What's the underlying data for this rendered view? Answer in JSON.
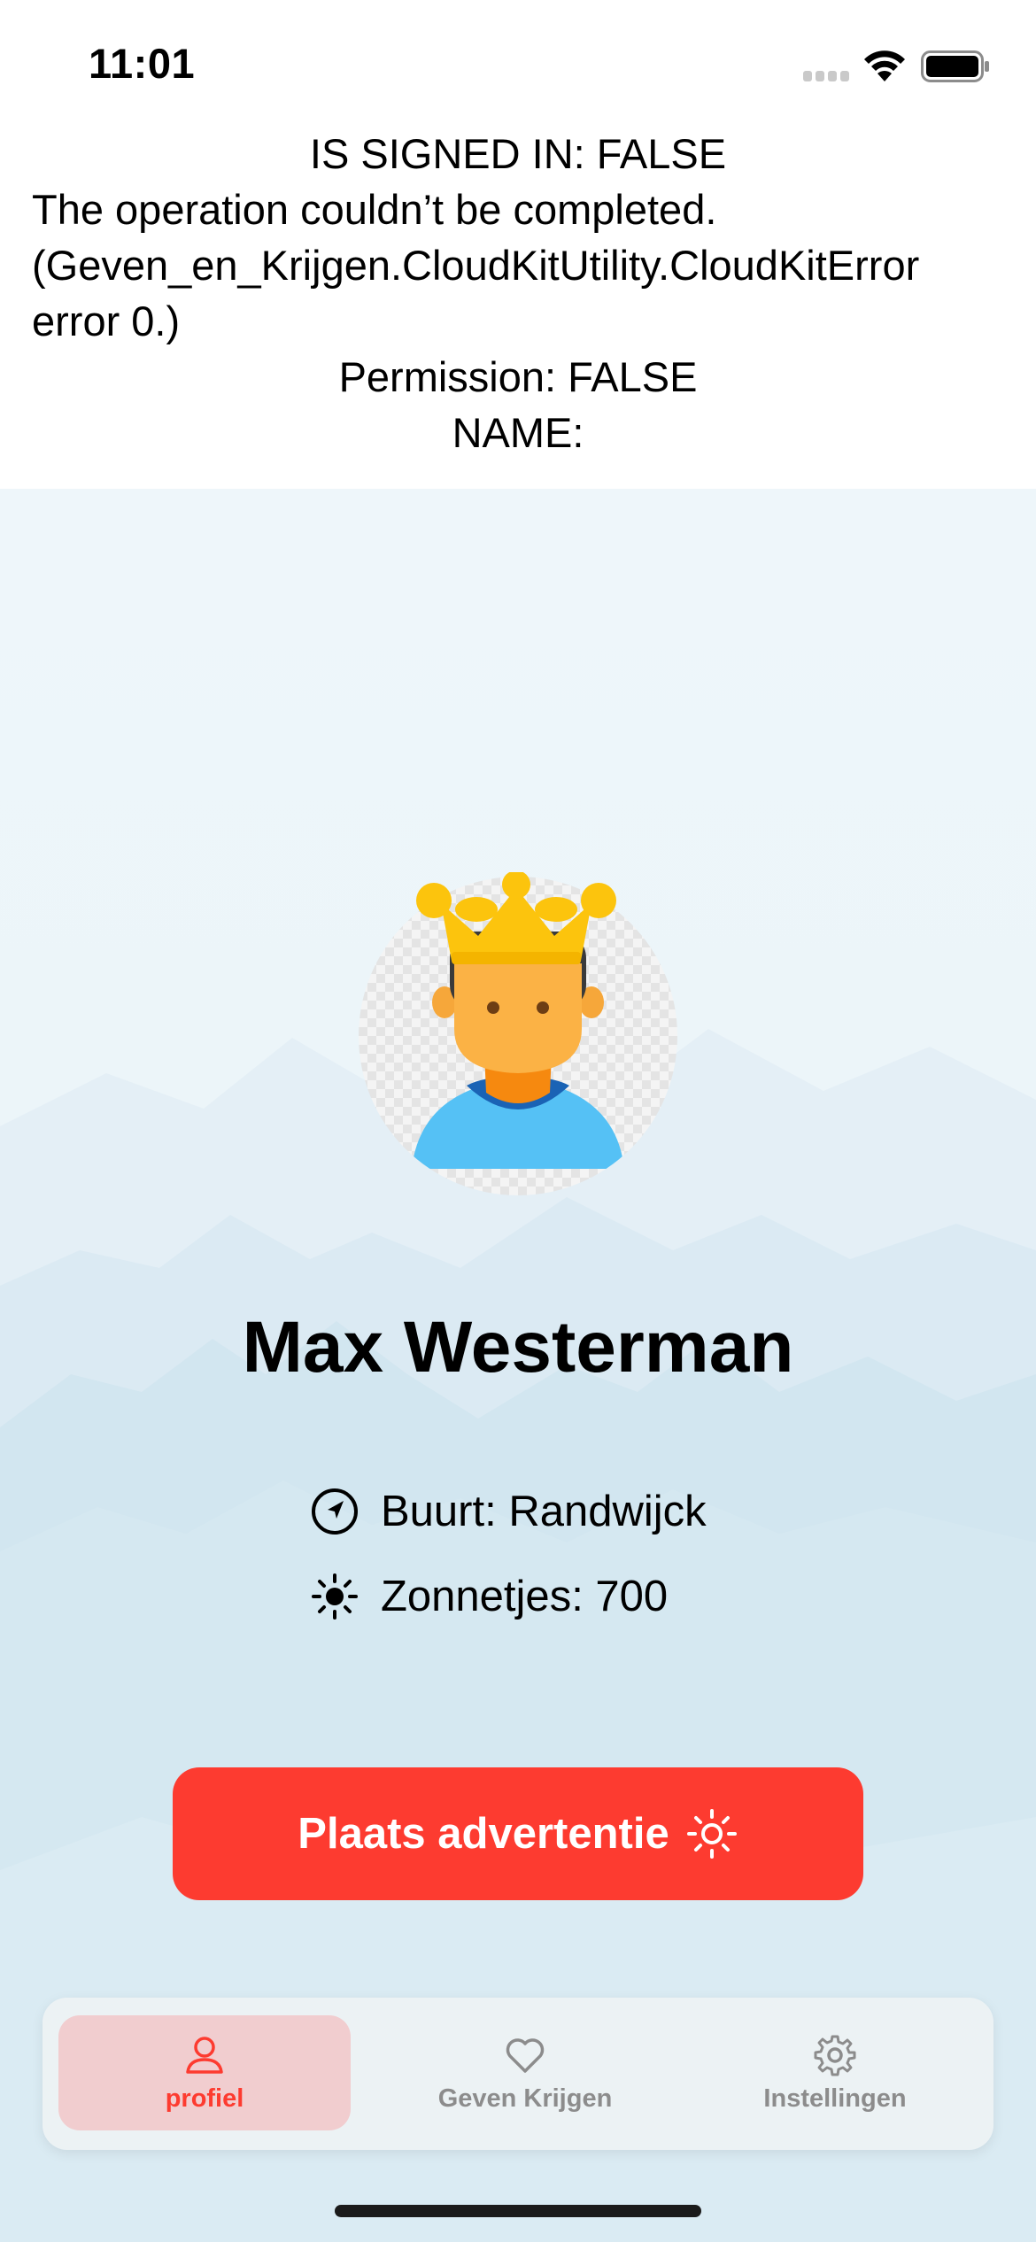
{
  "status_bar": {
    "time": "11:01"
  },
  "debug": {
    "signed_in": "IS SIGNED IN: FALSE",
    "error_line1": "The operation couldn’t be completed.",
    "error_line2": "(Geven_en_Krijgen.CloudKitUtility.CloudKitError",
    "error_line3": "error 0.)",
    "permission": "Permission: FALSE",
    "name": "NAME:"
  },
  "profile": {
    "name": "Max Westerman",
    "buurt": "Buurt: Randwijck",
    "zonnetjes": "Zonnetjes: 700"
  },
  "button": {
    "label": "Plaats advertentie"
  },
  "tabs": [
    {
      "label": "profiel",
      "icon": "person-icon",
      "selected": true
    },
    {
      "label": "Geven Krijgen",
      "icon": "heart-icon",
      "selected": false
    },
    {
      "label": "Instellingen",
      "icon": "gear-icon",
      "selected": false
    }
  ],
  "colors": {
    "accent": "#fd3b30",
    "tab_selected_bg": "#f1cdcf",
    "tab_inactive": "#8c8c8c"
  }
}
